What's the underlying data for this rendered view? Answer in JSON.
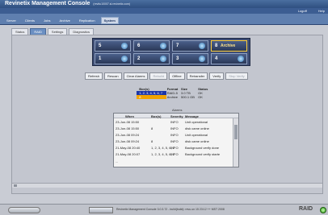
{
  "app": {
    "title": "Revinetix Management Console",
    "host": "(revitu10007.sl.revinetix.com)"
  },
  "top_links": [
    "Logoff",
    "Help"
  ],
  "menu": [
    "Server",
    "Clients",
    "Jobs",
    "Archive",
    "Replication",
    "System"
  ],
  "active_menu_index": 5,
  "subtabs": [
    "Status",
    "RAID",
    "Settings",
    "Diagnostics"
  ],
  "active_subtab_index": 1,
  "drives": [
    {
      "num": "5",
      "label": ""
    },
    {
      "num": "6",
      "label": ""
    },
    {
      "num": "7",
      "label": ""
    },
    {
      "num": "8",
      "label": "Archive"
    },
    {
      "num": "1",
      "label": ""
    },
    {
      "num": "2",
      "label": ""
    },
    {
      "num": "3",
      "label": ""
    },
    {
      "num": "4",
      "label": ""
    }
  ],
  "buttons": {
    "refresh": "Refresh",
    "rescan": "Rescan",
    "clear_alarms": "Clear Alarms",
    "rebuild": "Rebuild",
    "offline": "Offline",
    "retransfer": "Retransfer",
    "verify": "Verify",
    "stop_verify": "Stop Verify"
  },
  "array_table": {
    "headers": [
      "Box(s)",
      "Format",
      "Size",
      "Status"
    ],
    "rows": [
      {
        "boxes": "1, 2, 3, 4, 5, 6, 7",
        "format": "RAID-5",
        "size": "3.0 TB",
        "status": "OK"
      },
      {
        "boxes": "8",
        "format": "Archive",
        "size": "500.1 GB",
        "status": "OK"
      }
    ]
  },
  "alarms": {
    "title": "Alarms",
    "headers": [
      "When",
      "Box(s)",
      "Severity",
      "Message"
    ],
    "rows": [
      {
        "when": "23-Jun-08 15:50",
        "box": "",
        "severity": "INFO",
        "message": "Unit operational"
      },
      {
        "when": "23-Jun-08 15:50",
        "box": "8",
        "severity": "INFO",
        "message": "disk came online"
      },
      {
        "when": "23-Jun-08 09:24",
        "box": "",
        "severity": "INFO",
        "message": "Unit operational"
      },
      {
        "when": "23-Jun-08 09:24",
        "box": "8",
        "severity": "INFO",
        "message": "disk came online"
      },
      {
        "when": "21-May-08 20:40",
        "box": "1, 2, 3, 4, 5, 6, 7",
        "severity": "INFO",
        "message": "Background verify done"
      },
      {
        "when": "21-May-08 20:07",
        "box": "1, 2, 3, 4, 5, 6, 7",
        "severity": "INFO",
        "message": "Background verify starte"
      },
      {
        "when": "...",
        "box": "",
        "severity": "",
        "message": ""
      }
    ]
  },
  "status_bar": {
    "text": "Revinetix Management Console 3.0.3.72 - build(build): revu.un 15 23:12 ++ MST 2008",
    "raid_label": "RAID"
  },
  "colors": {
    "accent": "#3c5d92",
    "selected_row": "#1c36a8",
    "archive_row": "#f2a400",
    "ok_led": "#2d9a16"
  }
}
